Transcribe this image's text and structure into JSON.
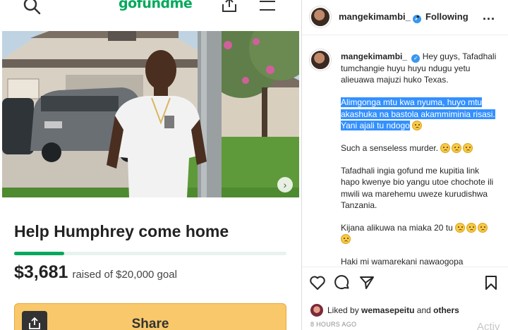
{
  "gofundme": {
    "logo": "gofundme",
    "title": "Help Humphrey come home",
    "raised_amount": "$3,681",
    "raised_text": "raised of $20,000 goal",
    "progress_fraction": 0.184,
    "share_label": "Share"
  },
  "instagram": {
    "header": {
      "username": "mangekimambi_",
      "dot": "•",
      "follow_status": "Following",
      "more": "..."
    },
    "caption": {
      "username": "mangekimambi_",
      "intro": "Hey guys, Tafadhali tumchangie huyu huyu ndugu yetu alieuawa majuzi huko Texas.",
      "highlighted": "Alimgonga mtu kwa nyuma, huyo mtu akashuka na bastola akammiminia risasi. Yani ajali tu ndogo",
      "p2": "Such a senseless murder.",
      "p3": "Tafadhali ingia gofund me kupitia link hapo kwenye bio yangu utoe chochote ili mwili wa marehemu uweze kurudishwa Tanzania.",
      "p4": "Kijana alikuwa na miaka 20 tu",
      "p5": "Haki mi wamarekani nawaogopa"
    },
    "liked_prefix": "Liked by",
    "liked_user": "wemasepeitu",
    "liked_and": "and",
    "liked_others": "others",
    "time": "8 HOURS AGO"
  },
  "watermark": "Activ",
  "colors": {
    "gofundme_green": "#02a95c",
    "share_button": "#f8c86a",
    "highlight": "#3390ff",
    "verified": "#3897f0"
  },
  "icons": [
    "search-icon",
    "upload-icon",
    "menu-icon",
    "chevron-right-icon",
    "verified-icon",
    "heart-icon",
    "comment-icon",
    "send-icon",
    "bookmark-icon",
    "crying-emoji"
  ]
}
